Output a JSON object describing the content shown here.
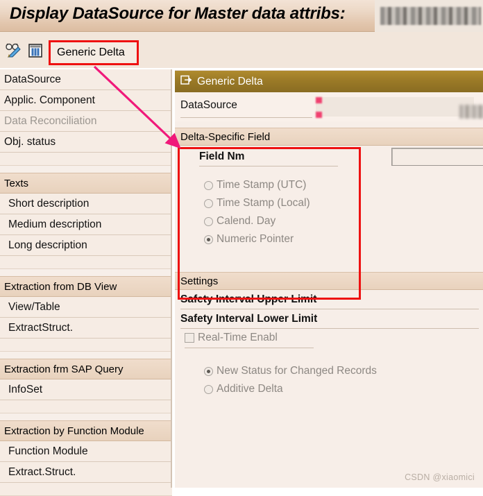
{
  "window": {
    "title": "Display DataSource for Master data attribs:",
    "title_value_redacted": true
  },
  "toolbar": {
    "icons": [
      {
        "name": "display-change-icon"
      },
      {
        "name": "table-grid-icon"
      }
    ],
    "tab_label": "Generic Delta",
    "highlight_color": "#ee1111"
  },
  "sidebar": {
    "groups": [
      {
        "rows": [
          {
            "label": "DataSource",
            "type": "field",
            "disabled": false
          },
          {
            "label": "Applic. Component",
            "type": "field",
            "disabled": false
          },
          {
            "label": "Data Reconciliation",
            "type": "field",
            "disabled": true
          },
          {
            "label": "Obj. status",
            "type": "field",
            "disabled": false
          }
        ]
      },
      {
        "rows": [
          {
            "label": "Texts",
            "type": "head",
            "disabled": false
          },
          {
            "label": "Short description",
            "type": "field",
            "disabled": false
          },
          {
            "label": "Medium description",
            "type": "field",
            "disabled": false
          },
          {
            "label": "Long description",
            "type": "field",
            "disabled": false
          }
        ]
      },
      {
        "rows": [
          {
            "label": "Extraction from DB View",
            "type": "head",
            "disabled": false
          },
          {
            "label": "View/Table",
            "type": "field",
            "disabled": false
          },
          {
            "label": "ExtractStruct.",
            "type": "field",
            "disabled": false
          }
        ]
      },
      {
        "rows": [
          {
            "label": "Extraction frm SAP Query",
            "type": "head",
            "disabled": false
          },
          {
            "label": "InfoSet",
            "type": "field",
            "disabled": false
          }
        ]
      },
      {
        "rows": [
          {
            "label": "Extraction by Function Module",
            "type": "head",
            "disabled": false
          },
          {
            "label": "Function Module",
            "type": "field",
            "disabled": false
          },
          {
            "label": "Extract.Struct.",
            "type": "field",
            "disabled": false
          }
        ]
      }
    ]
  },
  "panel": {
    "header_title": "Generic Delta",
    "header_icon": "export-window-icon",
    "datasource": {
      "label": "DataSource",
      "value_redacted": true
    },
    "delta_field": {
      "title": "Delta-Specific Field",
      "field_label": "Field Nm",
      "field_value": "",
      "options": [
        {
          "label": "Time Stamp (UTC)",
          "selected": false,
          "disabled": true
        },
        {
          "label": "Time Stamp (Local)",
          "selected": false,
          "disabled": true
        },
        {
          "label": "Calend. Day",
          "selected": false,
          "disabled": true
        },
        {
          "label": "Numeric Pointer",
          "selected": true,
          "disabled": true
        }
      ]
    },
    "settings": {
      "title": "Settings",
      "fields": [
        {
          "label": "Safety Interval Upper Limit",
          "value": ""
        },
        {
          "label": "Safety Interval Lower Limit",
          "value": ""
        }
      ],
      "checkbox": {
        "label": "Real-Time Enabl",
        "checked": false,
        "disabled": true
      },
      "options": [
        {
          "label": "New Status for Changed Records",
          "selected": true,
          "disabled": true
        },
        {
          "label": "Additive Delta",
          "selected": false,
          "disabled": true
        }
      ]
    }
  },
  "annotation": {
    "arrow_color": "#f0197a",
    "box_color": "#ee1111"
  },
  "watermark": "CSDN @xiaomici"
}
